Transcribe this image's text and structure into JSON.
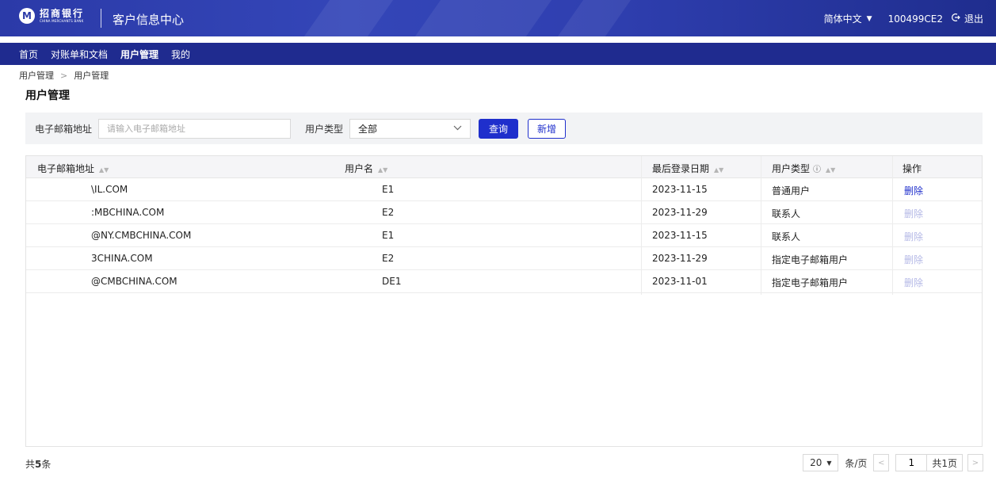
{
  "header": {
    "logo_cn": "招商银行",
    "logo_en": "CHINA MERCHANTS BANK",
    "app_title": "客户信息中心",
    "language": "简体中文",
    "user_id": "100499CE2",
    "logout": "退出"
  },
  "nav": {
    "items": [
      {
        "label": "首页"
      },
      {
        "label": "对账单和文档"
      },
      {
        "label": "用户管理"
      },
      {
        "label": "我的"
      }
    ]
  },
  "breadcrumb": {
    "parent": "用户管理",
    "separator": ">",
    "current": "用户管理"
  },
  "page_title": "用户管理",
  "filter": {
    "email_label": "电子邮箱地址",
    "email_placeholder": "请输入电子邮箱地址",
    "email_value": "",
    "type_label": "用户类型",
    "type_value": "全部",
    "query_button": "查询",
    "add_button": "新增"
  },
  "table": {
    "columns": [
      "电子邮箱地址",
      "用户名",
      "最后登录日期",
      "用户类型",
      "操作"
    ],
    "rows": [
      {
        "email": "\\IL.COM",
        "username": "E1",
        "last_login": "2023-11-15",
        "user_type": "普通用户",
        "action": "删除",
        "action_enabled": true
      },
      {
        "email": ":MBCHINA.COM",
        "username": "E2",
        "last_login": "2023-11-29",
        "user_type": "联系人",
        "action": "删除",
        "action_enabled": false
      },
      {
        "email": "@NY.CMBCHINA.COM",
        "username": "E1",
        "last_login": "2023-11-15",
        "user_type": "联系人",
        "action": "删除",
        "action_enabled": false
      },
      {
        "email": "3CHINA.COM",
        "username": "E2",
        "last_login": "2023-11-29",
        "user_type": "指定电子邮箱用户",
        "action": "删除",
        "action_enabled": false
      },
      {
        "email": "@CMBCHINA.COM",
        "username": "DE1",
        "last_login": "2023-11-01",
        "user_type": "指定电子邮箱用户",
        "action": "删除",
        "action_enabled": false
      }
    ]
  },
  "footer": {
    "total_prefix": "共",
    "total_count": "5",
    "total_suffix": "条",
    "page_size": "20",
    "per_page": "条/页",
    "current_page": "1",
    "total_pages": "共1页"
  },
  "colors": {
    "header_blue": "#2b3aa8",
    "nav_blue": "#1f2b8f",
    "primary": "#1f2fcc",
    "disabled_link": "#b4b8e6"
  },
  "icons": {
    "logo": "cmb-logo-icon",
    "language_caret": "caret-down-icon",
    "logout": "logout-icon",
    "sort": "sort-icon",
    "help": "help-circle-icon",
    "select_chevron": "chevron-down-icon",
    "prev": "chevron-left-icon",
    "next": "chevron-right-icon"
  }
}
